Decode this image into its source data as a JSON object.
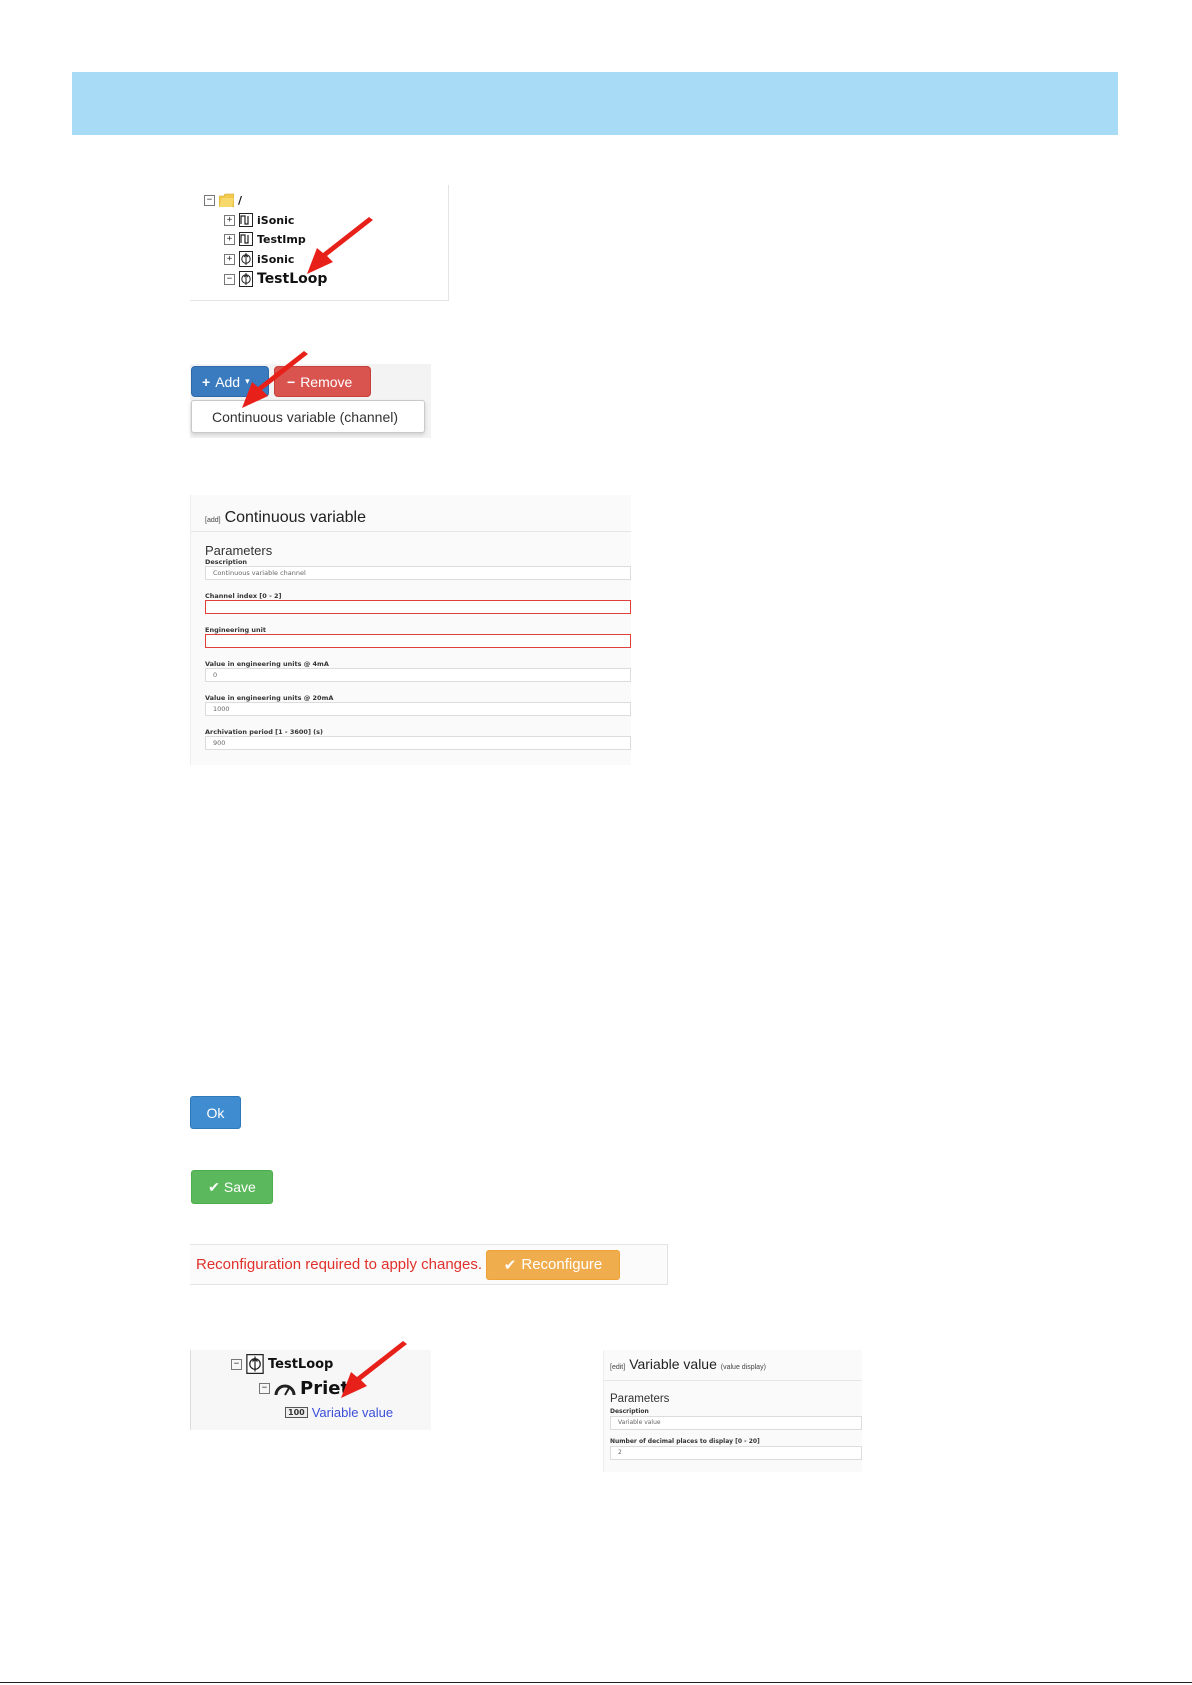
{
  "tree_root": {
    "root_label": "/",
    "items": [
      {
        "label": "iSonic",
        "type": "pulse"
      },
      {
        "label": "TestImp",
        "type": "pulse"
      },
      {
        "label": "iSonic",
        "type": "loop"
      },
      {
        "label": "TestLoop",
        "type": "loop"
      }
    ]
  },
  "toolbar": {
    "add_label": "Add",
    "remove_label": "Remove",
    "menu_item": "Continuous variable (channel)"
  },
  "form_add": {
    "tag": "[add]",
    "title": "Continuous variable",
    "section": "Parameters",
    "fields": [
      {
        "label": "Description",
        "value": "Continuous variable channel"
      },
      {
        "label": "Channel index [0 - 2]",
        "value": ""
      },
      {
        "label": "Engineering unit",
        "value": ""
      },
      {
        "label": "Value in engineering units @ 4mA",
        "value": "0"
      },
      {
        "label": "Value in engineering units @ 20mA",
        "value": "1000"
      },
      {
        "label": "Archivation period [1 - 3600] (s)",
        "value": "900"
      }
    ]
  },
  "buttons": {
    "ok": "Ok",
    "save": "Save"
  },
  "reconfigure": {
    "message": "Reconfiguration required to apply changes.",
    "button": "Reconfigure"
  },
  "tree_child": {
    "parent": "TestLoop",
    "group": "Priet",
    "badge": "100",
    "leaf": "Variable value"
  },
  "form_edit": {
    "tag": "[edit]",
    "title": "Variable value",
    "subtitle": "(value display)",
    "section": "Parameters",
    "fields": [
      {
        "label": "Description",
        "value": "Variable value"
      },
      {
        "label": "Number of decimal places to display [0 - 20]",
        "value": "2"
      }
    ]
  },
  "colors": {
    "header": "#a8dcf6",
    "primary": "#3a7bc0",
    "danger": "#d9534f",
    "success": "#5cb85c",
    "warning": "#f0ad4e",
    "error_text": "#e0302b",
    "arrow": "#e8201a"
  }
}
